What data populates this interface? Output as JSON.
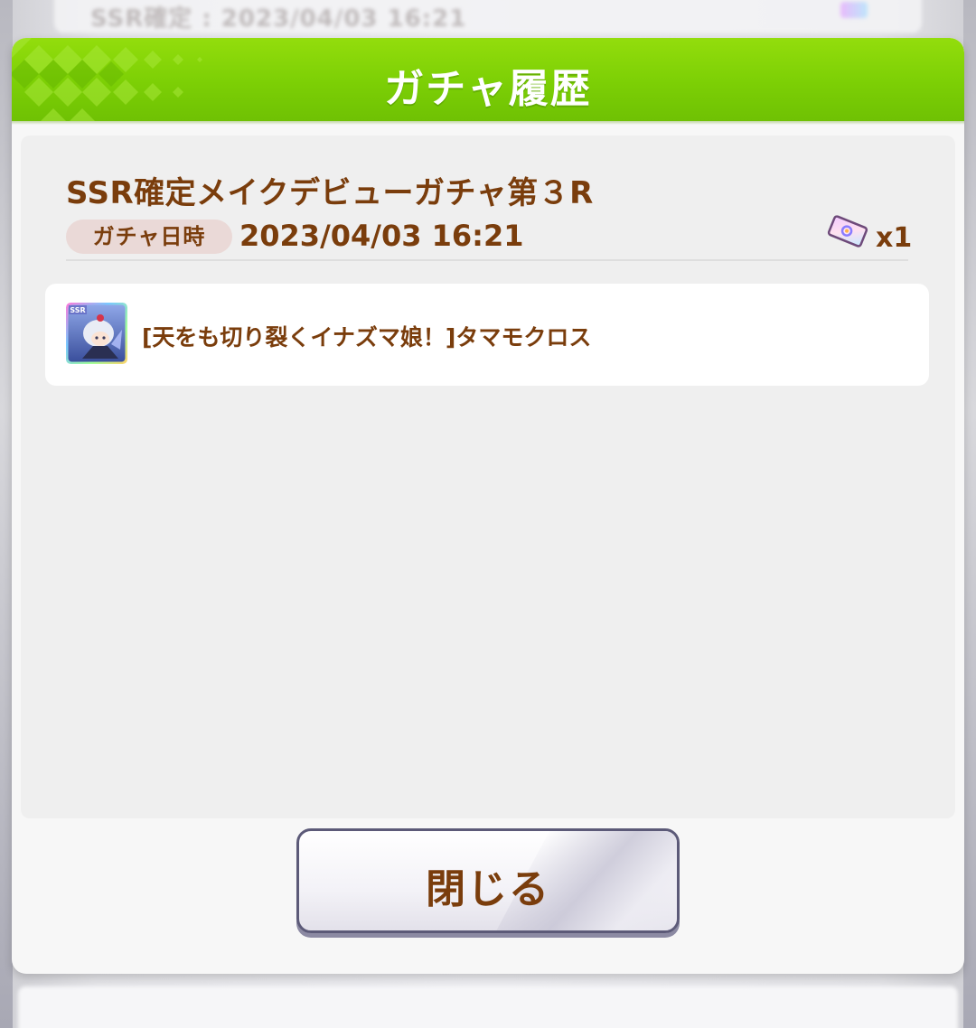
{
  "background": {
    "top_row_text": "SSR確定 : 2023/04/03 16:21"
  },
  "dialog": {
    "title": "ガチャ履歴",
    "gacha_name": "SSR確定メイクデビューガチャ第３R",
    "date_label": "ガチャ日時",
    "date_value": "2023/04/03 16:21",
    "ticket_icon": "gacha-ticket-icon",
    "ticket_count": "x1",
    "results": [
      {
        "rarity": "SSR",
        "name": "[天をも切り裂くイナズマ娘！]タマモクロス",
        "thumbnail": "character-portrait"
      }
    ],
    "close_label": "閉じる"
  },
  "colors": {
    "header_green": "#7ccf05",
    "text_brown": "#7a3d0c",
    "label_pill": "#ead9d7",
    "button_border": "#5c5a78"
  }
}
